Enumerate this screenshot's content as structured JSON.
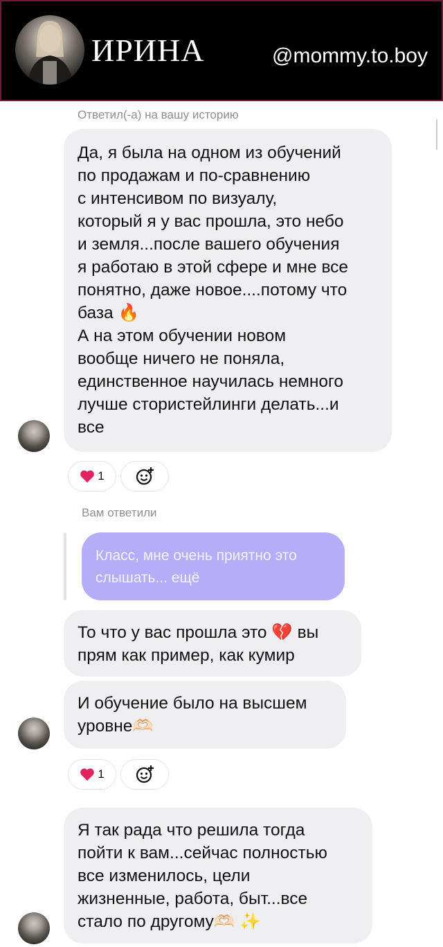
{
  "header": {
    "name": "ИРИНА",
    "handle": "@mommy.to.boy"
  },
  "story_reply_label": "Ответил(-а) на вашу историю",
  "message1": "Да, я была на одном из обучений\nпо продажам и по-сравнению\nс интенсивом по визуалу,\nкоторый я у вас прошла, это небо\nи земля...после вашего обучения\nя работаю в этой сфере и мне все\nпонятно, даже новое....потому что\nбаза 🔥\nА на этом обучении новом\nвообще ничего не поняла,\nединственное научилась немного\nлучше стористейлинги делать...и\nвсе",
  "reaction1": {
    "emoji": "❤️",
    "count": "1"
  },
  "you_replied_label": "Вам ответили",
  "quoted_reply": "Класс, мне очень приятно это\nслышать... ещё",
  "message2": "То что у вас прошла это 💔 вы\nпрям как пример, как кумир",
  "message3": "И обучение было на высшем\nуровне🫶🏻",
  "reaction2": {
    "emoji": "❤️",
    "count": "1"
  },
  "message4": "Я так рада что решила тогда\nпойти к вам...сейчас полностью\nвсе изменилось, цели\nжизненные, работа, быт...все\nстало по другому🫶🏻 ✨",
  "colors": {
    "header_bg": "#000000",
    "header_border": "#6e1d36",
    "bubble_bg": "#efeff2",
    "reply_bubble_bg": "#b5adf7",
    "heart": "#e0245e"
  }
}
